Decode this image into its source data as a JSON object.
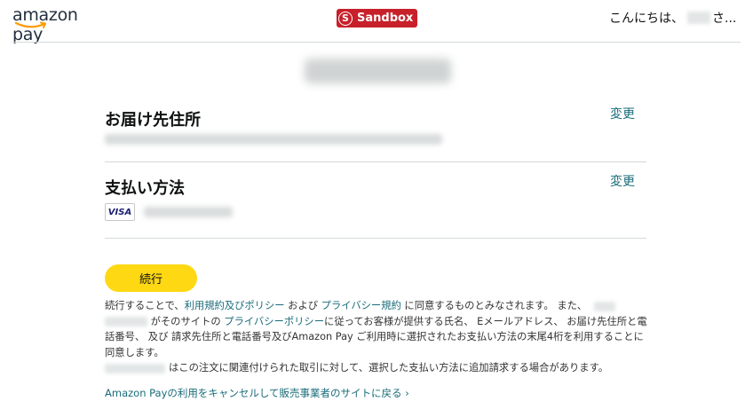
{
  "header": {
    "logo_text": "amazon pay",
    "sandbox_icon": "S",
    "sandbox_label": "Sandbox",
    "greeting_prefix": "こんにちは、",
    "greeting_suffix": "さ..."
  },
  "shipping": {
    "title": "お届け先住所",
    "change_label": "変更"
  },
  "payment": {
    "title": "支払い方法",
    "change_label": "変更",
    "card_brand": "VISA"
  },
  "actions": {
    "continue_label": "続行",
    "cancel_label": "Amazon Payの利用をキャンセルして販売事業者のサイトに戻る ›"
  },
  "terms": {
    "t1": "続行することで、",
    "link_terms": "利用規約及びポリシー",
    "t2": " および ",
    "link_privacy": "プライバシー規約",
    "t3": " に同意するものとみなされます。 また、",
    "t4": " がそのサイトの ",
    "link_privacy_policy": "プライバシーポリシー",
    "t5": "に従ってお客様が提供する氏名、 Eメールアドレス、 お届け先住所と電話番号、 及び 請求先住所と電話番号及びAmazon Pay ご利用時に選択されたお支払い方法の末尾4桁を利用することに同意します。",
    "t6": "はこの注文に関連付けられた取引に対して、選択した支払い方法に追加請求する場合があります。"
  },
  "colors": {
    "accent_link": "#1a6c7a",
    "button_yellow": "#ffd814",
    "sandbox_red": "#c7202a",
    "divider": "#d5d9d9"
  }
}
